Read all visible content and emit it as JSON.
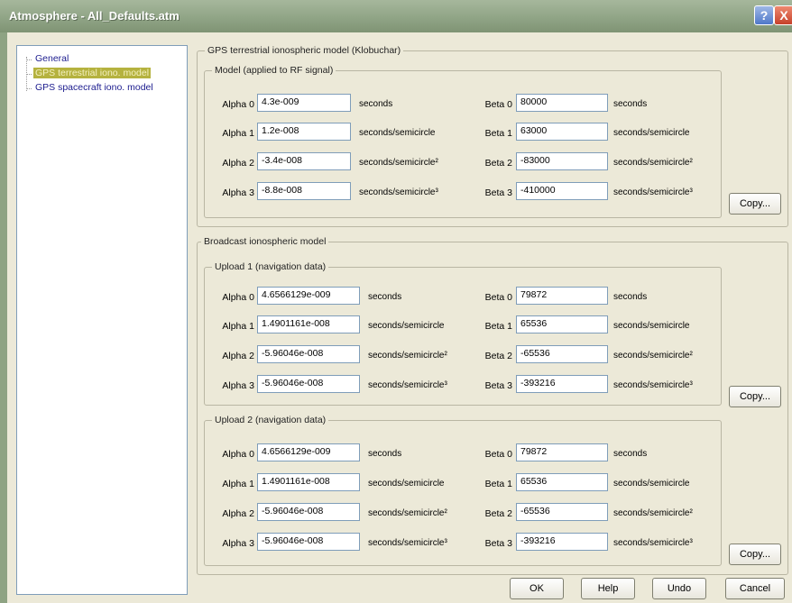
{
  "window": {
    "title": "Atmosphere - All_Defaults.atm",
    "help_glyph": "?",
    "close_glyph": "X"
  },
  "tree": {
    "items": [
      "General",
      "GPS terrestrial iono. model",
      "GPS spacecraft iono. model"
    ]
  },
  "klobuchar": {
    "title": "GPS terrestrial ionospheric model (Klobuchar)",
    "model": {
      "title": "Model (applied to RF signal)",
      "alpha": [
        {
          "label": "Alpha 0",
          "value": "4.3e-009",
          "unit": "seconds"
        },
        {
          "label": "Alpha 1",
          "value": "1.2e-008",
          "unit": "seconds/semicircle"
        },
        {
          "label": "Alpha 2",
          "value": "-3.4e-008",
          "unit": "seconds/semicircle²"
        },
        {
          "label": "Alpha 3",
          "value": "-8.8e-008",
          "unit": "seconds/semicircle³"
        }
      ],
      "beta": [
        {
          "label": "Beta 0",
          "value": "80000",
          "unit": "seconds"
        },
        {
          "label": "Beta 1",
          "value": "63000",
          "unit": "seconds/semicircle"
        },
        {
          "label": "Beta 2",
          "value": "-83000",
          "unit": "seconds/semicircle²"
        },
        {
          "label": "Beta 3",
          "value": "-410000",
          "unit": "seconds/semicircle³"
        }
      ],
      "copy_label": "Copy..."
    }
  },
  "broadcast": {
    "title": "Broadcast ionospheric model",
    "upload1": {
      "title": "Upload 1 (navigation data)",
      "alpha": [
        {
          "label": "Alpha 0",
          "value": "4.6566129e-009",
          "unit": "seconds"
        },
        {
          "label": "Alpha 1",
          "value": "1.4901161e-008",
          "unit": "seconds/semicircle"
        },
        {
          "label": "Alpha 2",
          "value": "-5.96046e-008",
          "unit": "seconds/semicircle²"
        },
        {
          "label": "Alpha 3",
          "value": "-5.96046e-008",
          "unit": "seconds/semicircle³"
        }
      ],
      "beta": [
        {
          "label": "Beta 0",
          "value": "79872",
          "unit": "seconds"
        },
        {
          "label": "Beta 1",
          "value": "65536",
          "unit": "seconds/semicircle"
        },
        {
          "label": "Beta 2",
          "value": "-65536",
          "unit": "seconds/semicircle²"
        },
        {
          "label": "Beta 3",
          "value": "-393216",
          "unit": "seconds/semicircle³"
        }
      ],
      "copy_label": "Copy..."
    },
    "upload2": {
      "title": "Upload 2 (navigation data)",
      "alpha": [
        {
          "label": "Alpha 0",
          "value": "4.6566129e-009",
          "unit": "seconds"
        },
        {
          "label": "Alpha 1",
          "value": "1.4901161e-008",
          "unit": "seconds/semicircle"
        },
        {
          "label": "Alpha 2",
          "value": "-5.96046e-008",
          "unit": "seconds/semicircle²"
        },
        {
          "label": "Alpha 3",
          "value": "-5.96046e-008",
          "unit": "seconds/semicircle³"
        }
      ],
      "beta": [
        {
          "label": "Beta 0",
          "value": "79872",
          "unit": "seconds"
        },
        {
          "label": "Beta 1",
          "value": "65536",
          "unit": "seconds/semicircle"
        },
        {
          "label": "Beta 2",
          "value": "-65536",
          "unit": "seconds/semicircle²"
        },
        {
          "label": "Beta 3",
          "value": "-393216",
          "unit": "seconds/semicircle³"
        }
      ],
      "copy_label": "Copy..."
    }
  },
  "footer": {
    "ok": "OK",
    "help": "Help",
    "undo": "Undo",
    "cancel": "Cancel"
  }
}
